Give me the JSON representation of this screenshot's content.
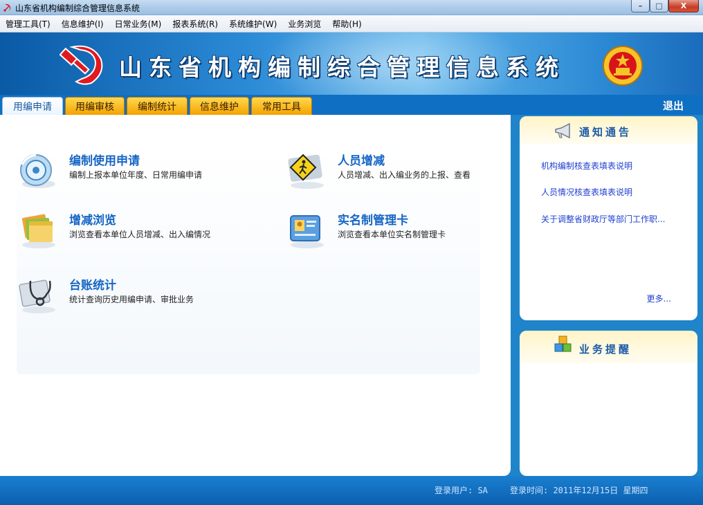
{
  "window": {
    "title": "山东省机构编制综合管理信息系统",
    "minimize_label": "–",
    "maximize_label": "□",
    "close_label": "X"
  },
  "menu": [
    "管理工具(T)",
    "信息维护(I)",
    "日常业务(M)",
    "报表系统(R)",
    "系统维护(W)",
    "业务浏览",
    "帮助(H)"
  ],
  "banner": {
    "title": "山东省机构编制综合管理信息系统"
  },
  "tabs": [
    {
      "label": "用编申请",
      "active": true
    },
    {
      "label": "用编审核",
      "active": false
    },
    {
      "label": "编制统计",
      "active": false
    },
    {
      "label": "信息维护",
      "active": false
    },
    {
      "label": "常用工具",
      "active": false
    }
  ],
  "logout_label": "退出",
  "functions": [
    {
      "title": "编制使用申请",
      "desc": "编制上报本单位年度、日常用编申请",
      "icon": "disc-icon"
    },
    {
      "title": "人员增减",
      "desc": "人员增减、出入编业务的上报、查看",
      "icon": "pedestrian-sign-icon"
    },
    {
      "title": "增减浏览",
      "desc": "浏览查看本单位人员增减、出入编情况",
      "icon": "folders-icon"
    },
    {
      "title": "实名制管理卡",
      "desc": "浏览查看本单位实名制管理卡",
      "icon": "id-card-icon"
    },
    {
      "title": "台账统计",
      "desc": "统计查询历史用编申请、审批业务",
      "icon": "stethoscope-icon"
    }
  ],
  "notice": {
    "title": "通知通告",
    "items": [
      "机构编制核查表填表说明",
      "人员情况核查表填表说明",
      "关于调整省财政厅等部门工作职..."
    ],
    "more": "更多..."
  },
  "reminder": {
    "title": "业务提醒"
  },
  "status": {
    "user": "登录用户: SA",
    "time": "登录时间: 2011年12月15日 星期四"
  },
  "colors": {
    "accent_blue": "#1666c4",
    "tab_orange": "#f4a200",
    "link_blue": "#1f3fd0",
    "banner_blue": "#2b8ad6"
  }
}
